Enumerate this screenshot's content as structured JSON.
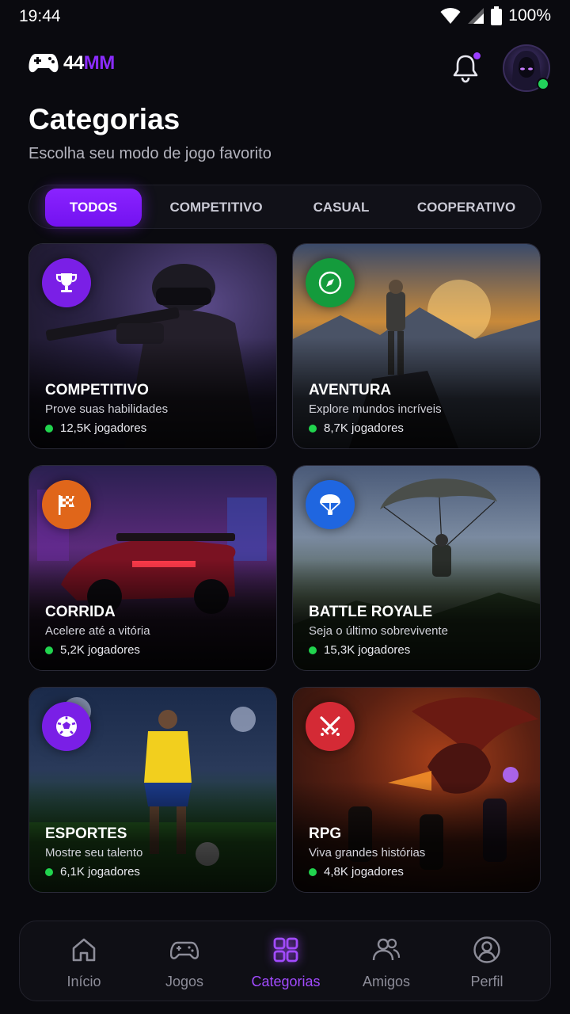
{
  "status_bar": {
    "time": "19:44",
    "battery": "100%"
  },
  "header": {
    "logo_a": "44",
    "logo_b": "MM"
  },
  "page": {
    "title": "Categorias",
    "subtitle": "Escolha seu modo de jogo favorito"
  },
  "tabs": [
    {
      "label": "TODOS",
      "active": true
    },
    {
      "label": "COMPETITIVO",
      "active": false
    },
    {
      "label": "CASUAL",
      "active": false
    },
    {
      "label": "COOPERATIVO",
      "active": false
    }
  ],
  "categories": [
    {
      "title": "COMPETITIVO",
      "description": "Prove suas habilidades",
      "players": "12,5K jogadores",
      "icon": "trophy-icon",
      "icon_color": "#7a1fe6"
    },
    {
      "title": "AVENTURA",
      "description": "Explore mundos incríveis",
      "players": "8,7K jogadores",
      "icon": "compass-icon",
      "icon_color": "#149b3c"
    },
    {
      "title": "CORRIDA",
      "description": "Acelere até a vitória",
      "players": "5,2K jogadores",
      "icon": "checkered-flag-icon",
      "icon_color": "#e0661a"
    },
    {
      "title": "BATTLE ROYALE",
      "description": "Seja o último sobrevivente",
      "players": "15,3K jogadores",
      "icon": "parachute-icon",
      "icon_color": "#1f66e0"
    },
    {
      "title": "ESPORTES",
      "description": "Mostre seu talento",
      "players": "6,1K jogadores",
      "icon": "soccer-ball-icon",
      "icon_color": "#7a1fe6"
    },
    {
      "title": "RPG",
      "description": "Viva grandes histórias",
      "players": "4,8K jogadores",
      "icon": "crossed-swords-icon",
      "icon_color": "#d42a35"
    }
  ],
  "nav": [
    {
      "label": "Início",
      "icon": "home-icon",
      "active": false
    },
    {
      "label": "Jogos",
      "icon": "gamepad-icon",
      "active": false
    },
    {
      "label": "Categorias",
      "icon": "grid-icon",
      "active": true
    },
    {
      "label": "Amigos",
      "icon": "friends-icon",
      "active": false
    },
    {
      "label": "Perfil",
      "icon": "profile-icon",
      "active": false
    }
  ],
  "colors": {
    "accent": "#8a23ff",
    "online": "#21d44e",
    "background": "#0a0a0f"
  }
}
